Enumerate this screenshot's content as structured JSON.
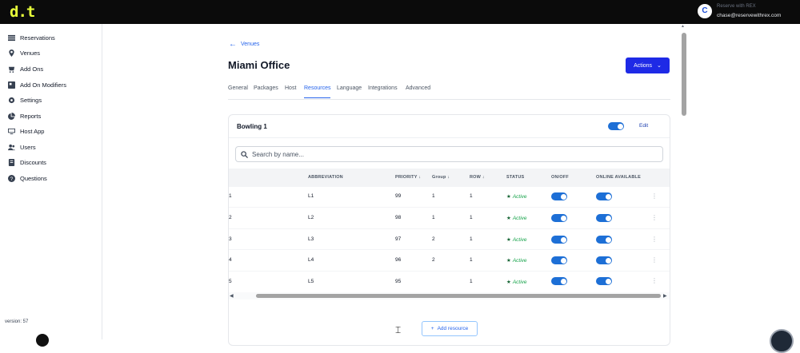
{
  "app": {
    "logo": "d.t"
  },
  "user": {
    "name": "Reserve with REX",
    "email": "chase@reservewithrex.com",
    "avatar_letter": "C"
  },
  "sidebar": {
    "items": [
      {
        "label": "Reservations",
        "icon": "list-icon"
      },
      {
        "label": "Venues",
        "icon": "map-pin-icon"
      },
      {
        "label": "Add Ons",
        "icon": "cart-icon"
      },
      {
        "label": "Add On Modifiers",
        "icon": "modifier-icon"
      },
      {
        "label": "Settings",
        "icon": "gear-icon"
      },
      {
        "label": "Reports",
        "icon": "pie-chart-icon"
      },
      {
        "label": "Host App",
        "icon": "monitor-icon"
      },
      {
        "label": "Users",
        "icon": "users-icon"
      },
      {
        "label": "Discounts",
        "icon": "discount-icon"
      },
      {
        "label": "Questions",
        "icon": "question-icon"
      }
    ],
    "version": "version: 57"
  },
  "header": {
    "back_label": "Venues",
    "title": "Miami Office",
    "actions_label": "Actions"
  },
  "tabs": [
    {
      "label": "General",
      "active": false
    },
    {
      "label": "Packages",
      "active": false
    },
    {
      "label": "Host",
      "active": false
    },
    {
      "label": "Resources",
      "active": true
    },
    {
      "label": "Language",
      "active": false
    },
    {
      "label": "Integrations",
      "active": false
    },
    {
      "label": "Advanced",
      "active": false
    }
  ],
  "card": {
    "title": "Bowling 1",
    "enabled": true,
    "edit_label": "Edit",
    "search_placeholder": "Search by name..."
  },
  "table": {
    "columns": [
      "ABBREVIATION",
      "PRIORITY ↓",
      "Group ↓",
      "ROW ↓",
      "STATUS",
      "ON/OFF",
      "ONLINE AVAILABLE"
    ],
    "rows": [
      {
        "id": "1",
        "abbreviation": "L1",
        "priority": "99",
        "group": "1",
        "row": "1",
        "status": "Active",
        "on": true,
        "online": true
      },
      {
        "id": "2",
        "abbreviation": "L2",
        "priority": "98",
        "group": "1",
        "row": "1",
        "status": "Active",
        "on": true,
        "online": true
      },
      {
        "id": "3",
        "abbreviation": "L3",
        "priority": "97",
        "group": "2",
        "row": "1",
        "status": "Active",
        "on": true,
        "online": true
      },
      {
        "id": "4",
        "abbreviation": "L4",
        "priority": "96",
        "group": "2",
        "row": "1",
        "status": "Active",
        "on": true,
        "online": true
      },
      {
        "id": "5",
        "abbreviation": "L5",
        "priority": "95",
        "group": "",
        "row": "1",
        "status": "Active",
        "on": true,
        "online": true
      }
    ]
  },
  "add_resource_label": "Add resource",
  "colors": {
    "primary": "#1e2ae6",
    "link": "#2563eb",
    "active_status": "#16a34a",
    "logo": "#e8ff3a"
  }
}
